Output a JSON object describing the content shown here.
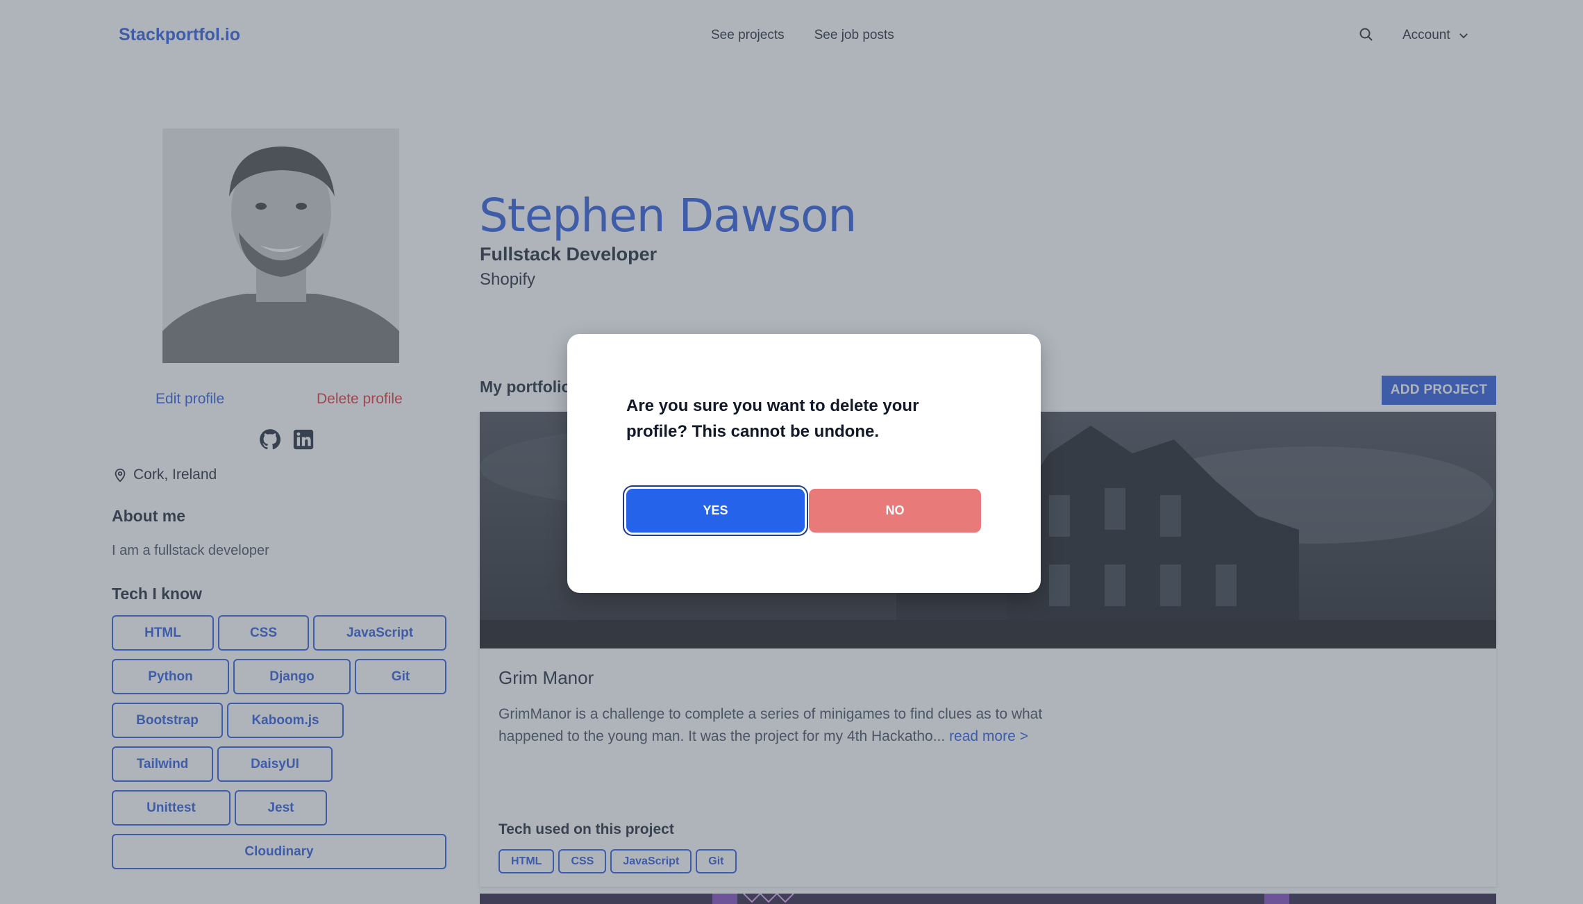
{
  "header": {
    "brand": "Stackportfol.io",
    "nav": [
      "See projects",
      "See job posts"
    ],
    "account_label": "Account"
  },
  "profile": {
    "name": "Stephen Dawson",
    "role": "Fullstack Developer",
    "company": "Shopify",
    "edit_label": "Edit profile",
    "delete_label": "Delete profile",
    "location": "Cork, Ireland",
    "about_title": "About me",
    "about_text": "I am a fullstack developer",
    "tech_title": "Tech I know",
    "tech": [
      "HTML",
      "CSS",
      "JavaScript",
      "Python",
      "Django",
      "Git",
      "Bootstrap",
      "Kaboom.js",
      "Tailwind",
      "DaisyUI",
      "Unittest",
      "Jest",
      "Cloudinary"
    ]
  },
  "portfolio": {
    "title": "My portfolio",
    "add_label": "ADD PROJECT",
    "project": {
      "title": "Grim Manor",
      "description": "GrimManor is a challenge to complete a series of minigames to find clues as to what happened to the young man. It was the project for my 4th Hackatho...",
      "read_more": "read more >",
      "tech_title": "Tech used on this project",
      "tech": [
        "HTML",
        "CSS",
        "JavaScript",
        "Git"
      ]
    }
  },
  "modal": {
    "message": "Are you sure you want to delete your profile? This cannot be undone.",
    "yes_label": "YES",
    "no_label": "NO"
  },
  "colors": {
    "primary": "#1d4ed8",
    "danger": "#dc2626",
    "yes_button": "#2563eb",
    "no_button": "#e97a7a"
  }
}
